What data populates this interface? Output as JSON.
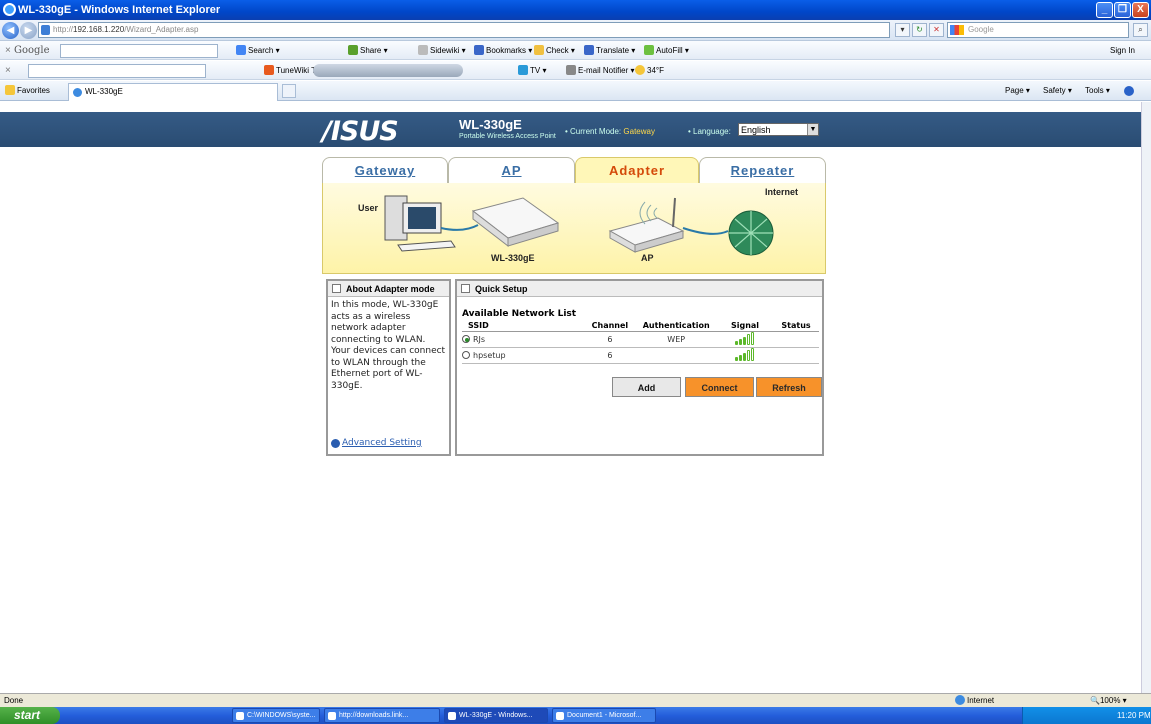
{
  "window": {
    "title": "WL-330gE - Windows Internet Explorer",
    "min": "_",
    "max": "❐",
    "close": "X"
  },
  "addressbar": {
    "url_prefix": "http://",
    "url_host": "192.168.1.220",
    "url_path": "/Wizard_Adapter.asp",
    "search_placeholder": "Google"
  },
  "google_toolbar": {
    "brand": "Google",
    "items": [
      "Search",
      "Share",
      "Sidewiki",
      "Bookmarks",
      "Check",
      "Translate",
      "AutoFill"
    ],
    "sign_in": "Sign In"
  },
  "second_toolbar": {
    "items": [
      "TuneWiki Top 50",
      "TV",
      "E-mail Notifier",
      "34°F"
    ]
  },
  "favorites": {
    "label": "Favorites",
    "tab": "WL-330gE",
    "right_items": [
      "Page",
      "Safety",
      "Tools"
    ]
  },
  "header": {
    "logo": "/ISUS",
    "model": "WL-330gE",
    "model_sub": "Portable Wireless Access Point",
    "current_mode_label": "• Current Mode:",
    "current_mode": "Gateway",
    "language_label": "• Language:",
    "language": "English"
  },
  "mode_tabs": [
    {
      "label": "Gateway",
      "active": false
    },
    {
      "label": "AP",
      "active": false
    },
    {
      "label": "Adapter",
      "active": true
    },
    {
      "label": "Repeater",
      "active": false
    }
  ],
  "diagram": {
    "user": "User",
    "device": "WL-330gE",
    "ap": "AP",
    "internet": "Internet"
  },
  "about": {
    "title": "About Adapter mode",
    "description": "In this mode, WL-330gE acts as a wireless network adapter connecting to WLAN. Your devices can connect to WLAN through the Ethernet port of WL-330gE.",
    "advanced_link": "Advanced Setting"
  },
  "quick_setup": {
    "title": "Quick Setup",
    "list_title": "Available Network List",
    "columns": [
      "SSID",
      "Channel",
      "Authentication",
      "Signal",
      "Status"
    ],
    "networks": [
      {
        "ssid": "RJs",
        "channel": "6",
        "auth": "WEP",
        "signal": 3,
        "status": "",
        "selected": true
      },
      {
        "ssid": "hpsetup",
        "channel": "6",
        "auth": "",
        "signal": 3,
        "status": "",
        "selected": false
      }
    ],
    "buttons": {
      "add": "Add",
      "connect": "Connect",
      "refresh": "Refresh"
    }
  },
  "statusbar": {
    "left": "Done",
    "zone": "Internet",
    "zoom": "100%"
  },
  "taskbar": {
    "start": "start",
    "tasks": [
      "C:\\WINDOWS\\syste...",
      "http://downloads.link...",
      "WL-330gE - Windows...",
      "Document1 - Microsof..."
    ],
    "clock": "11:20 PM"
  },
  "colors": {
    "banner": "#2f5580",
    "active_tab": "#d44a0a",
    "connect": "#f7922a",
    "signal": "#5cb82a"
  }
}
